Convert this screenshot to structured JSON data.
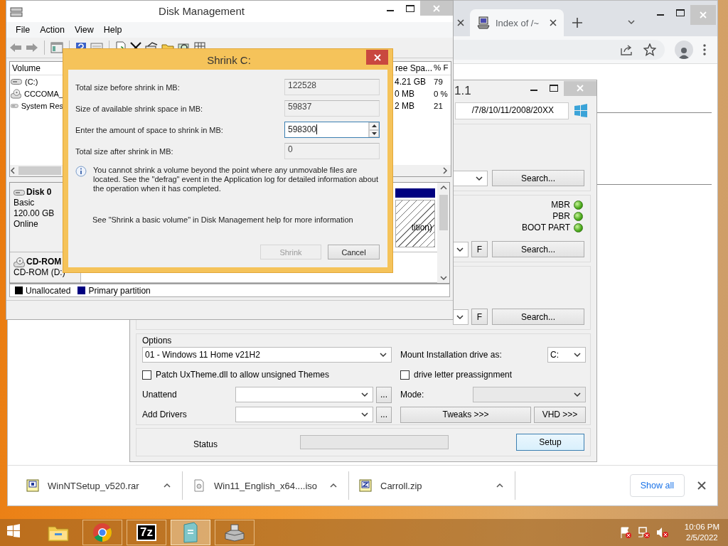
{
  "browser": {
    "tab": {
      "title": "Index of /~"
    },
    "downloads": [
      {
        "name": "WinNTSetup_v520.rar",
        "kind": "rar"
      },
      {
        "name": "Win11_English_x64....iso",
        "kind": "iso"
      },
      {
        "name": "Carroll.zip",
        "kind": "zip"
      }
    ],
    "show_all": "Show all"
  },
  "winntsetup": {
    "title": "1.1",
    "source_path": "/7/8/10/11/2008/20XX",
    "boot_checks": [
      {
        "label": "MBR",
        "on": true
      },
      {
        "label": "PBR",
        "on": true
      },
      {
        "label": "BOOT PART",
        "on": true
      }
    ],
    "search_buttons": [
      "Search...",
      "Search...",
      "Search..."
    ],
    "f_buttons": [
      "F",
      "F"
    ],
    "options": {
      "title": "Options",
      "edition": "01 - Windows 11 Home v21H2",
      "mount_label": "Mount Installation drive as:",
      "mount_drive": "C:",
      "patch_uxtheme": {
        "label": "Patch UxTheme.dll to allow unsigned Themes",
        "checked": false
      },
      "drive_letter": {
        "label": "drive letter preassignment",
        "checked": false
      },
      "unattend_label": "Unattend",
      "add_drivers_label": "Add Drivers",
      "browse_buttons": [
        "...",
        "..."
      ],
      "mode_label": "Mode:",
      "mode_disabled": true,
      "tweaks": "Tweaks >>>",
      "vhd": "VHD >>>"
    },
    "status": {
      "label": "Status",
      "level": 0,
      "setup": "Setup"
    }
  },
  "disk_management": {
    "title": "Disk Management",
    "menu": [
      "File",
      "Action",
      "View",
      "Help"
    ],
    "columns": [
      "Volume",
      "ree Spa...",
      "% F"
    ],
    "volumes": [
      {
        "name": "(C:)",
        "kind": "disk",
        "free": "4.21 GB",
        "percent": "79"
      },
      {
        "name": "CCCOMA_",
        "kind": "cd",
        "free": "0 MB",
        "percent": "0 %"
      },
      {
        "name": "System Res",
        "kind": "disk",
        "free": "2 MB",
        "percent": "21"
      }
    ],
    "disks": [
      {
        "name": "Disk 0",
        "kind": "disk",
        "details": [
          "Basic",
          "120.00 GB",
          "Online"
        ],
        "partition": "tition)"
      },
      {
        "name": "CD-ROM",
        "kind": "cd",
        "details": [
          "CD-ROM (D:)"
        ]
      }
    ],
    "legend": [
      {
        "label": "Unallocated",
        "color": "#000000"
      },
      {
        "label": "Primary partition",
        "color": "#000080"
      }
    ]
  },
  "shrink_dialog": {
    "title": "Shrink C:",
    "fields": [
      {
        "label": "Total size before shrink in MB:",
        "value": "122528",
        "kind": "readonly"
      },
      {
        "label": "Size of available shrink space in MB:",
        "value": "59837",
        "kind": "readonly"
      },
      {
        "label": "Enter the amount of space to shrink in MB:",
        "value": "598300",
        "kind": "spinner"
      },
      {
        "label": "Total size after shrink in MB:",
        "value": "0",
        "kind": "readonly"
      }
    ],
    "info": "You cannot shrink a volume beyond the point where any unmovable files are located. See the \"defrag\" event in the Application log for detailed information about the operation when it has completed.",
    "help": "See \"Shrink a basic volume\" in Disk Management help for more information",
    "buttons": [
      {
        "label": "Shrink",
        "disabled": true
      },
      {
        "label": "Cancel",
        "disabled": false
      }
    ]
  },
  "taskbar": {
    "apps": [
      {
        "kind": "explorer",
        "running": false,
        "active": false
      },
      {
        "kind": "chrome",
        "running": true,
        "active": false
      },
      {
        "kind": "sevenzip",
        "label": "7z",
        "running": true,
        "active": false
      },
      {
        "kind": "setup",
        "running": true,
        "active": true
      },
      {
        "kind": "drive",
        "running": true,
        "active": false
      }
    ],
    "time": "10:06 PM",
    "date": "2/5/2022"
  }
}
